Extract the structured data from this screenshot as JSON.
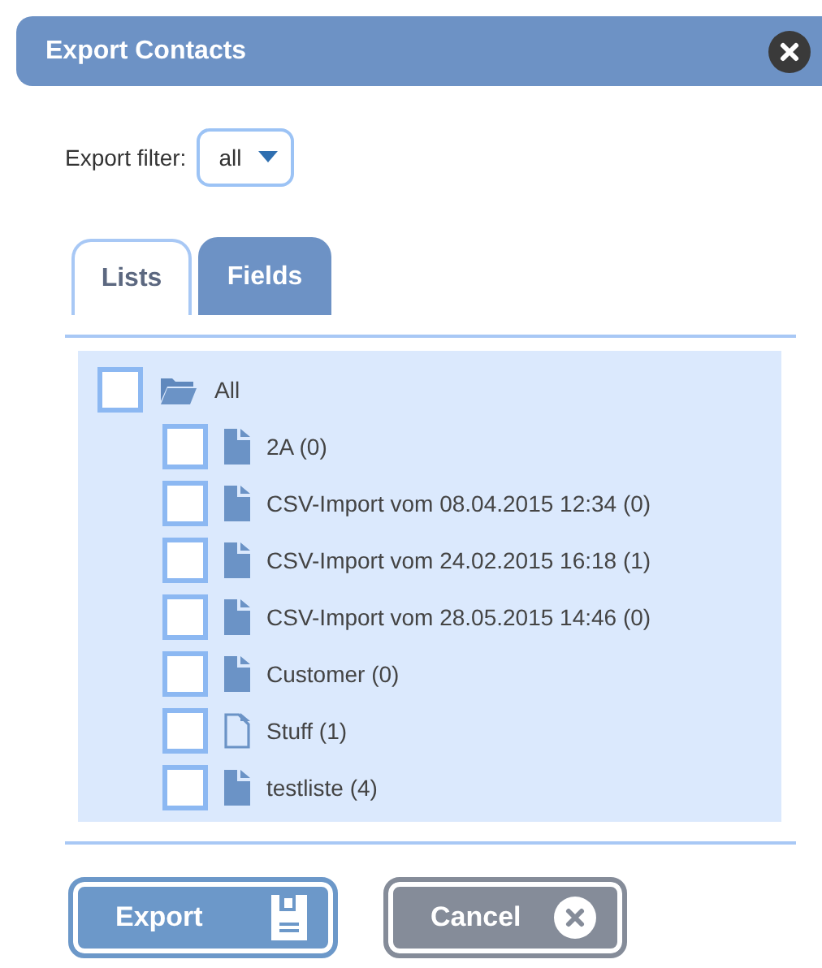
{
  "window": {
    "title": "Export Contacts"
  },
  "filter": {
    "label": "Export filter:",
    "value": "all"
  },
  "tabs": [
    {
      "label": "Lists",
      "selected": false
    },
    {
      "label": "Fields",
      "selected": true
    }
  ],
  "tree": {
    "label": "All",
    "checked": false,
    "expanded": true,
    "children": [
      {
        "label": "2A (0)",
        "checked": false,
        "kind": "filled"
      },
      {
        "label": "CSV-Import vom 08.04.2015 12:34 (0)",
        "checked": false,
        "kind": "filled"
      },
      {
        "label": "CSV-Import vom 24.02.2015 16:18 (1)",
        "checked": false,
        "kind": "filled"
      },
      {
        "label": "CSV-Import vom 28.05.2015 14:46 (0)",
        "checked": false,
        "kind": "filled"
      },
      {
        "label": "Customer (0)",
        "checked": false,
        "kind": "filled"
      },
      {
        "label": "Stuff (1)",
        "checked": false,
        "kind": "outline"
      },
      {
        "label": "testliste (4)",
        "checked": false,
        "kind": "filled"
      }
    ]
  },
  "buttons": [
    {
      "label": "Export",
      "kind": "save"
    },
    {
      "label": "Cancel",
      "kind": "cancel"
    }
  ]
}
